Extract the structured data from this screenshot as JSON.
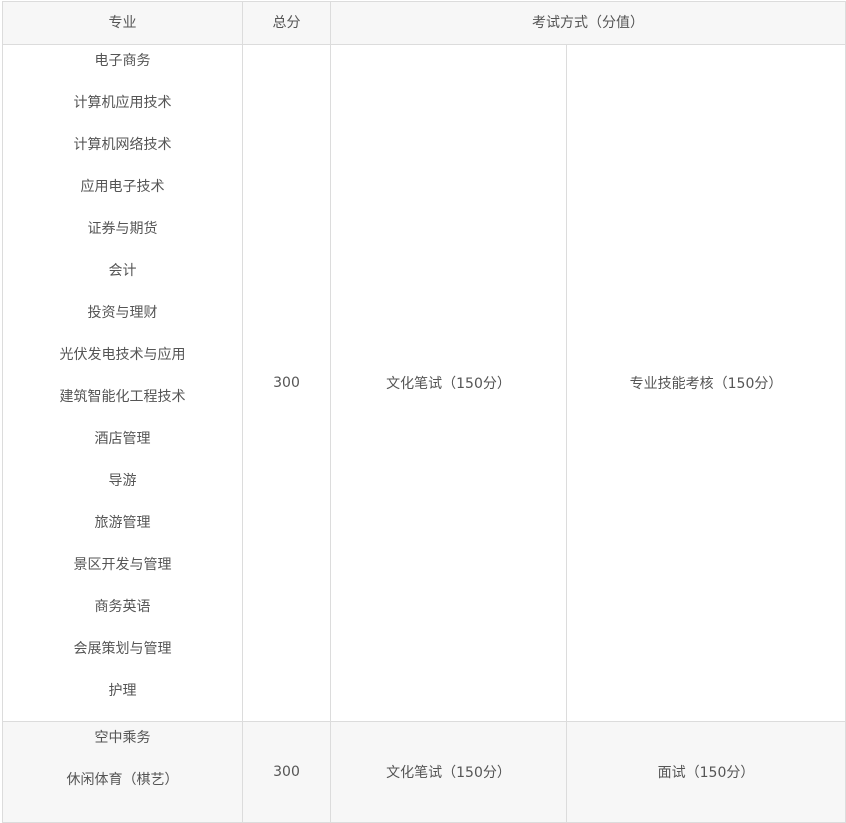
{
  "table": {
    "headers": {
      "major": "专业",
      "total": "总分",
      "exam": "考试方式（分值）"
    },
    "groups": [
      {
        "majors": [
          "电子商务",
          "计算机应用技术",
          "计算机网络技术",
          "应用电子技术",
          "证券与期货",
          "会计",
          "投资与理财",
          "光伏发电技术与应用",
          "建筑智能化工程技术",
          "酒店管理",
          "导游",
          "旅游管理",
          "景区开发与管理",
          "商务英语",
          "会展策划与管理",
          "护理"
        ],
        "total": "300",
        "exam_written": "文化笔试（150分）",
        "exam_other": "专业技能考核（150分）"
      },
      {
        "majors": [
          "空中乘务",
          "休闲体育（棋艺）"
        ],
        "total": "300",
        "exam_written": "文化笔试（150分）",
        "exam_other": "面试（150分）"
      }
    ]
  }
}
